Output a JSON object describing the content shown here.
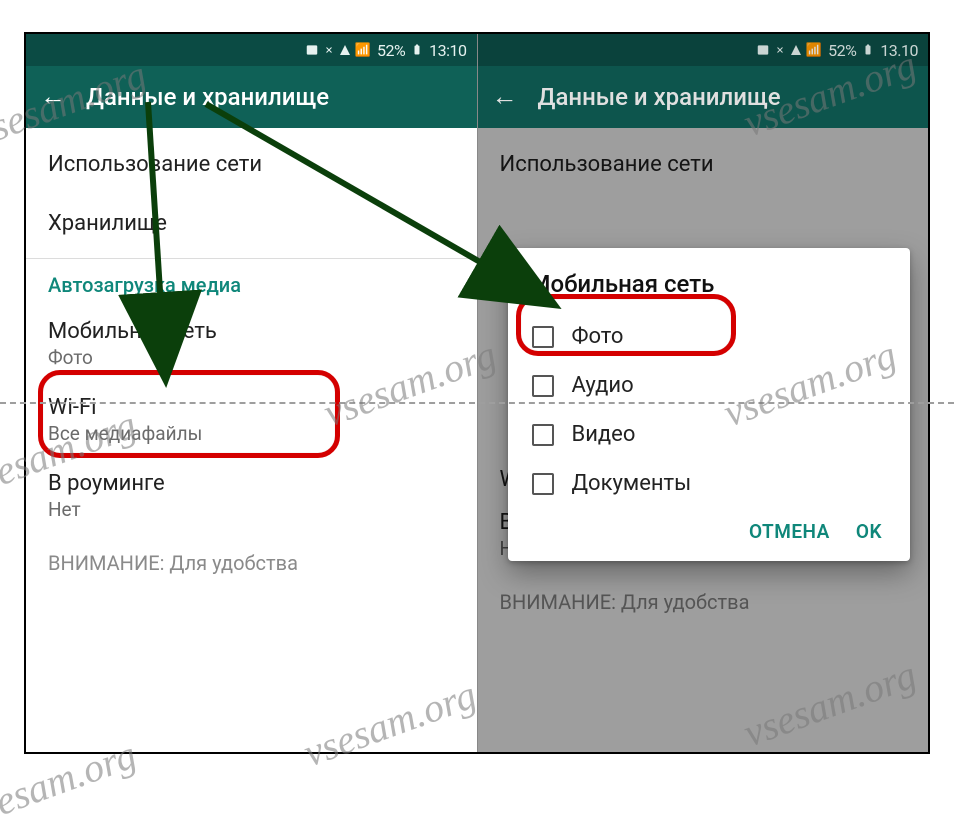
{
  "statusbar": {
    "battery_text": "52%",
    "time": "13:10",
    "time_alt": "13.10"
  },
  "appbar": {
    "title": "Данные и хранилище"
  },
  "left": {
    "usage": "Использование сети",
    "storage": "Хранилище",
    "section": "Автозагрузка медиа",
    "mobile_title": "Мобильная сеть",
    "mobile_sub": "Фото",
    "wifi_title": "Wi-Fi",
    "wifi_sub": "Все медиафайлы",
    "roaming_title": "В роуминге",
    "roaming_sub": "Нет",
    "footer": "ВНИМАНИЕ: Для удобства"
  },
  "right": {
    "usage": "Использование сети",
    "roaming_title": "В роуминге",
    "roaming_sub": "Нет",
    "footer": "ВНИМАНИЕ: Для удобства",
    "w_label": "W"
  },
  "dialog": {
    "title": "Мобильная сеть",
    "options": [
      "Фото",
      "Аудио",
      "Видео",
      "Документы"
    ],
    "cancel": "ОТМЕНА",
    "ok": "OK"
  },
  "watermark": "vsesam.org"
}
